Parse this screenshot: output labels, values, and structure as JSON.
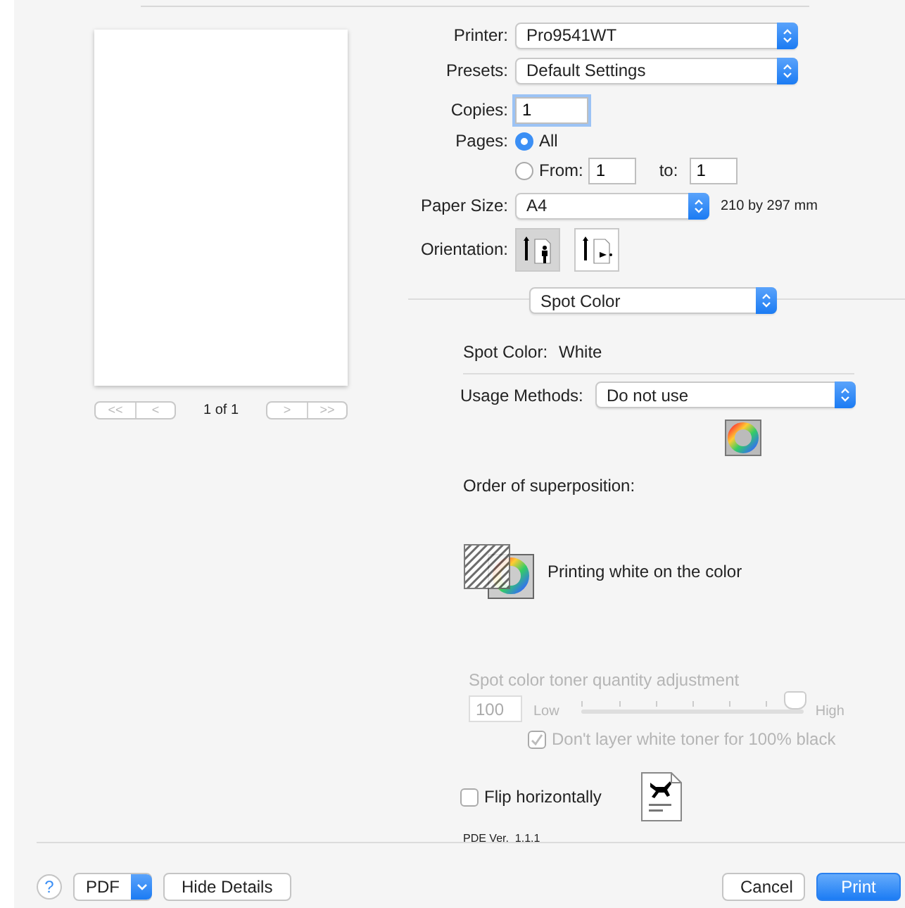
{
  "preview": {
    "page_indicator": "1 of 1",
    "nav_buttons": [
      {
        "label": "<<"
      },
      {
        "label": "<"
      },
      {
        "label": ">"
      },
      {
        "label": ">>"
      }
    ]
  },
  "printer": {
    "label": "Printer:",
    "value": "Pro9541WT"
  },
  "presets": {
    "label": "Presets:",
    "value": "Default Settings"
  },
  "copies": {
    "label": "Copies:",
    "value": "1"
  },
  "pages": {
    "label": "Pages:",
    "options": [
      {
        "label": "All",
        "selected": true
      },
      {
        "label": "From:",
        "selected": false
      }
    ],
    "from": "1",
    "to_label": "to:",
    "to": "1"
  },
  "paper_size": {
    "label": "Paper Size:",
    "value": "A4",
    "dimensions": "210 by 297 mm"
  },
  "orientation": {
    "label": "Orientation:",
    "options": [
      {
        "kind": "portrait",
        "selected": true
      },
      {
        "kind": "landscape",
        "selected": false
      }
    ]
  },
  "section_popup": "Spot Color",
  "spot_color": {
    "label": "Spot Color:",
    "value": "White"
  },
  "usage_methods": {
    "label": "Usage Methods:",
    "value": "Do not use"
  },
  "order_label": "Order of superposition:",
  "order_option": "Printing white on the color",
  "toner_adjustment": {
    "title": "Spot color toner quantity adjustment",
    "value": "100",
    "low": "Low",
    "high": "High",
    "level": 0.96,
    "disabled": true
  },
  "dont_layer": {
    "label": "Don't layer white toner for 100% black",
    "checked": true,
    "disabled": true
  },
  "flip": {
    "label": "Flip horizontally",
    "checked": false
  },
  "pde_version": "PDE Ver.  1.1.1",
  "footer": {
    "help": "?",
    "pdf": "PDF",
    "hide_details": "Hide Details",
    "cancel": "Cancel",
    "print": "Print"
  }
}
